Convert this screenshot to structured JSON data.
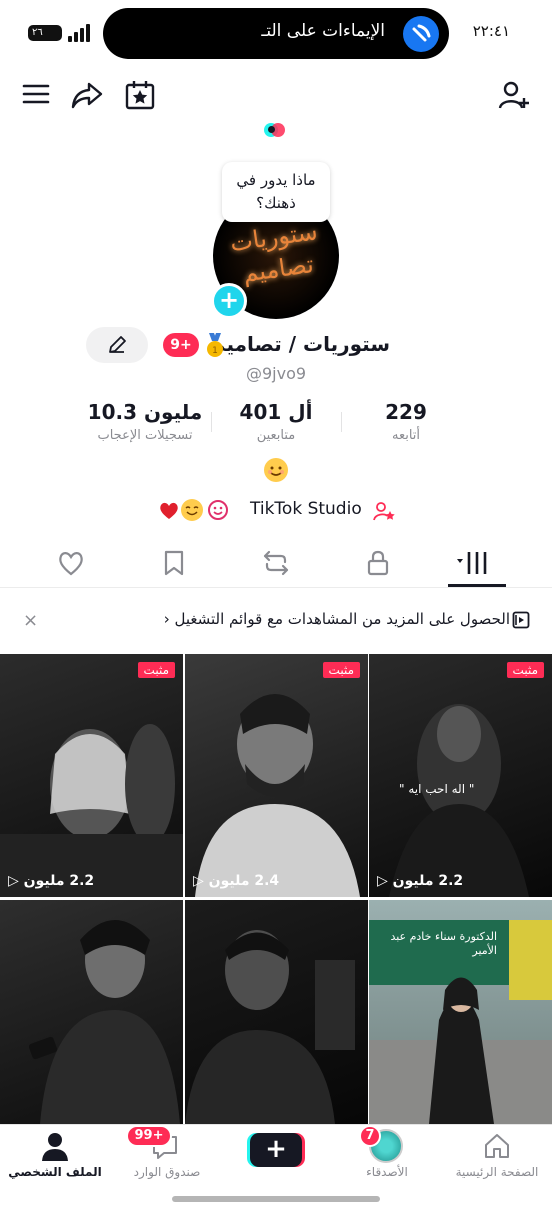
{
  "status_bar": {
    "time": "٢٢:٤١",
    "battery": "٢٦",
    "notification": "الإيماءات على التـ"
  },
  "profile": {
    "bubble_text": "ماذا يدور في ذهنك؟",
    "name": "ستوريات / تصاميم",
    "badge": "9+",
    "handle": "@9jvo9",
    "avatar_text": "ستوريات تصاميم"
  },
  "stats": [
    {
      "value": "229",
      "label": "أتابعه"
    },
    {
      "value": "401 أل",
      "label": "متابعين"
    },
    {
      "value": "10.3 مليون",
      "label": "تسجيلات الإعجاب"
    }
  ],
  "studio": {
    "label": "TikTok Studio"
  },
  "banner": {
    "text": "الحصول على المزيد من المشاهدات مع قوائم التشغيل",
    "chevron": "‹",
    "close": "×"
  },
  "videos": [
    {
      "pinned": "مثبت",
      "views": "2.2 مليون"
    },
    {
      "pinned": "مثبت",
      "views": "2.4 مليون"
    },
    {
      "pinned": "مثبت",
      "views": "2.2 مليون",
      "overlay": "\" اله احب ايه \""
    },
    {
      "views": ""
    },
    {
      "views": ""
    },
    {
      "views": "",
      "overlay": "الدكتورة سناء خادم عبد الأمير"
    }
  ],
  "bottom_nav": {
    "home": "الصفحة الرئيسية",
    "friends": "الأصدقاء",
    "friends_badge": "7",
    "create": "+",
    "inbox": "صندوق الوارد",
    "inbox_badge": "99+",
    "profile": "الملف الشخصي"
  },
  "colors": {
    "accent": "#fe2c55",
    "cyan": "#20d5ec"
  }
}
